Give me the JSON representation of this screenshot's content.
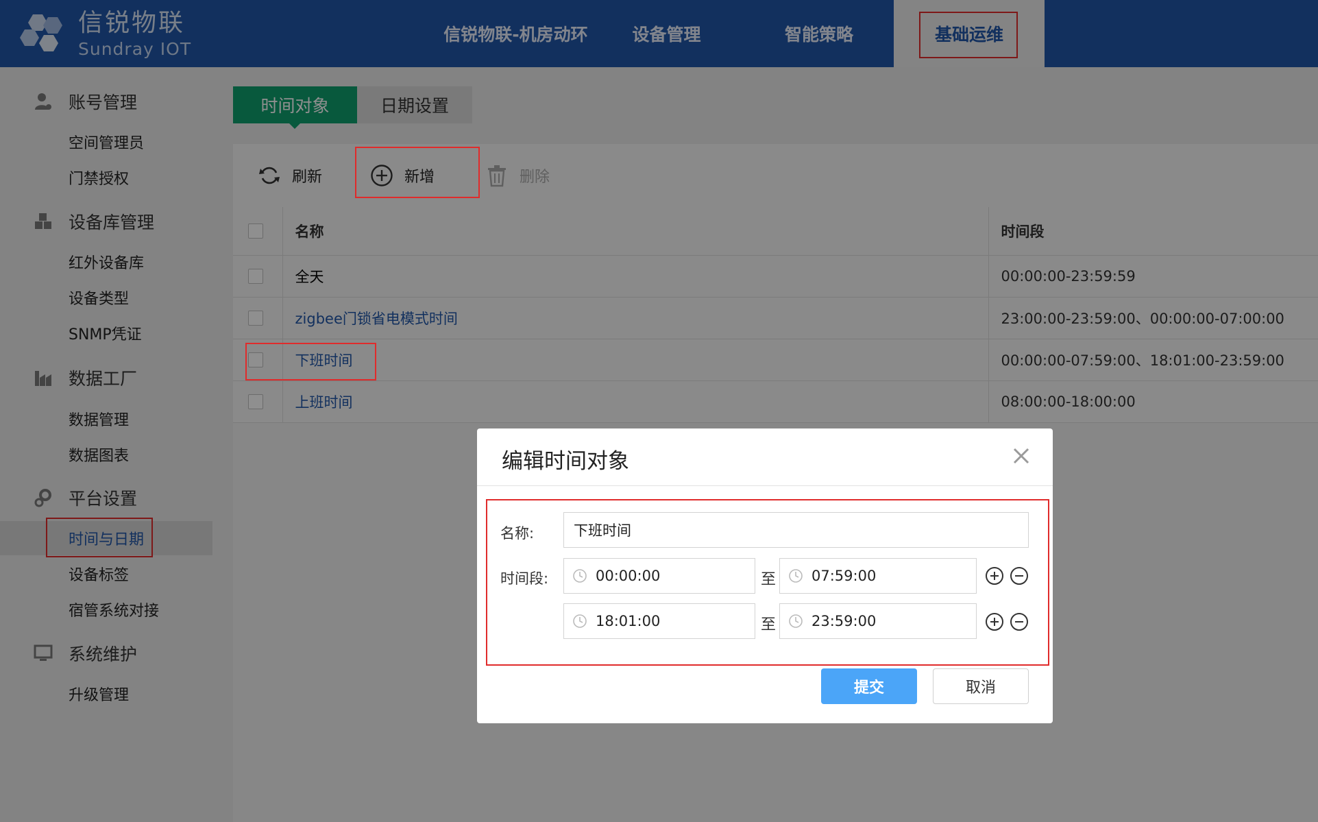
{
  "brand": {
    "name_cn": "信锐物联",
    "name_en": "Sundray IOT"
  },
  "nav": [
    {
      "label": "信锐物联-机房动环",
      "active": false
    },
    {
      "label": "设备管理",
      "active": false
    },
    {
      "label": "智能策略",
      "active": false
    },
    {
      "label": "基础运维",
      "active": true
    }
  ],
  "sidebar": {
    "groups": [
      {
        "label": "账号管理",
        "icon": "user-icon",
        "items": [
          "空间管理员",
          "门禁授权"
        ]
      },
      {
        "label": "设备库管理",
        "icon": "cubes-icon",
        "items": [
          "红外设备库",
          "设备类型",
          "SNMP凭证"
        ]
      },
      {
        "label": "数据工厂",
        "icon": "factory-icon",
        "items": [
          "数据管理",
          "数据图表"
        ]
      },
      {
        "label": "平台设置",
        "icon": "settings-icon",
        "items": [
          "时间与日期",
          "设备标签",
          "宿管系统对接"
        ]
      },
      {
        "label": "系统维护",
        "icon": "monitor-icon",
        "items": [
          "升级管理"
        ]
      }
    ],
    "active_item": "时间与日期"
  },
  "tabs": [
    {
      "label": "时间对象",
      "active": true
    },
    {
      "label": "日期设置",
      "active": false
    }
  ],
  "toolbar": {
    "refresh": "刷新",
    "add": "新增",
    "delete": "删除"
  },
  "table": {
    "headers": {
      "name": "名称",
      "time": "时间段"
    },
    "rows": [
      {
        "name": "全天",
        "time": "00:00:00-23:59:59",
        "link": false
      },
      {
        "name": "zigbee门锁省电模式时间",
        "time": "23:00:00-23:59:00、00:00:00-07:00:00",
        "link": true
      },
      {
        "name": "下班时间",
        "time": "00:00:00-07:59:00、18:01:00-23:59:00",
        "link": true
      },
      {
        "name": "上班时间",
        "time": "08:00:00-18:00:00",
        "link": true
      }
    ]
  },
  "dialog": {
    "title": "编辑时间对象",
    "name_label": "名称:",
    "name_value": "下班时间",
    "period_label": "时间段:",
    "to_label": "至",
    "periods": [
      {
        "start": "00:00:00",
        "end": "07:59:00"
      },
      {
        "start": "18:01:00",
        "end": "23:59:00"
      }
    ],
    "submit": "提交",
    "cancel": "取消"
  },
  "colors": {
    "header": "#2056a8",
    "tab_active": "#0f9f6e",
    "submit": "#4ba5f8",
    "highlight": "#e02b2b"
  }
}
